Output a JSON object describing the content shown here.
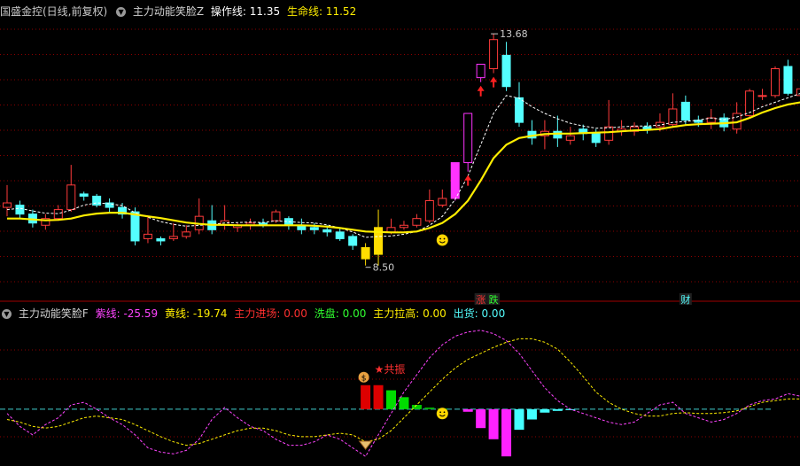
{
  "main_header": {
    "title": "国盛金控(日线,前复权)",
    "indicator": "主力动能笑脸Z",
    "op_label": "操作线:",
    "op_value": "11.35",
    "life_label": "生命线:",
    "life_value": "11.52"
  },
  "ind_header": {
    "name": "主力动能笑脸F",
    "purple_label": "紫线:",
    "purple_value": "-25.59",
    "yellow_label": "黄线:",
    "yellow_value": "-19.74",
    "enter_label": "主力进场:",
    "enter_value": "0.00",
    "wash_label": "洗盘:",
    "wash_value": "0.00",
    "pull_label": "主力拉高:",
    "pull_value": "0.00",
    "ship_label": "出货:",
    "ship_value": "0.00"
  },
  "colors": {
    "up": "#ff3b3b",
    "down": "#54ffff",
    "limit": "#ff33ff",
    "life": "#ffee00",
    "op": "#ffffff",
    "purple": "#ff44ff",
    "grid": "#8b0000",
    "zero": "#40d0d0"
  },
  "chart_data": [
    {
      "type": "candlestick",
      "ylim": [
        7.9,
        14.0
      ],
      "high_annotation": "13.68",
      "low_annotation": "8.50",
      "badges": [
        {
          "index": 37,
          "text": "涨",
          "color": "#ff3030"
        },
        {
          "index": 38,
          "text": "跌",
          "color": "#30ff30"
        },
        {
          "index": 53,
          "text": "财",
          "color": "#54ffff"
        }
      ],
      "candles": [
        [
          9.8,
          9.9,
          9.6,
          10.3
        ],
        [
          9.85,
          9.65,
          9.55,
          9.95
        ],
        [
          9.65,
          9.45,
          9.35,
          9.75
        ],
        [
          9.4,
          9.55,
          9.3,
          9.65
        ],
        [
          9.55,
          9.75,
          9.5,
          9.85
        ],
        [
          9.75,
          10.3,
          9.7,
          10.75
        ],
        [
          10.1,
          10.05,
          9.95,
          10.15
        ],
        [
          10.05,
          9.85,
          9.8,
          10.1
        ],
        [
          9.9,
          9.8,
          9.7,
          10.0
        ],
        [
          9.8,
          9.65,
          9.55,
          9.9
        ],
        [
          9.7,
          9.05,
          8.95,
          9.8
        ],
        [
          9.1,
          9.2,
          9.0,
          9.6
        ],
        [
          9.1,
          9.05,
          8.95,
          9.15
        ],
        [
          9.1,
          9.15,
          9.05,
          9.45
        ],
        [
          9.15,
          9.25,
          9.1,
          9.4
        ],
        [
          9.3,
          9.6,
          9.2,
          10.0
        ],
        [
          9.5,
          9.3,
          9.2,
          9.85
        ],
        [
          9.4,
          9.5,
          9.3,
          9.85
        ],
        [
          9.35,
          9.4,
          9.25,
          9.45
        ],
        [
          9.4,
          9.45,
          9.3,
          9.55
        ],
        [
          9.45,
          9.4,
          9.35,
          9.55
        ],
        [
          9.5,
          9.7,
          9.45,
          9.75
        ],
        [
          9.55,
          9.4,
          9.3,
          9.6
        ],
        [
          9.4,
          9.3,
          9.2,
          9.55
        ],
        [
          9.35,
          9.3,
          9.2,
          9.45
        ],
        [
          9.3,
          9.25,
          9.15,
          9.4
        ],
        [
          9.25,
          9.1,
          9.05,
          9.35
        ],
        [
          9.15,
          8.95,
          8.85,
          9.2
        ],
        [
          8.9,
          8.65,
          8.5,
          9.0
        ],
        [
          8.75,
          9.35,
          8.5,
          9.75
        ],
        [
          9.25,
          9.35,
          9.2,
          9.55
        ],
        [
          9.35,
          9.4,
          9.3,
          9.5
        ],
        [
          9.4,
          9.55,
          9.35,
          9.65
        ],
        [
          9.5,
          9.95,
          9.45,
          10.2
        ],
        [
          9.85,
          10.0,
          9.8,
          10.2
        ],
        [
          10.0,
          10.8,
          9.95,
          10.8
        ],
        [
          10.8,
          11.9,
          10.6,
          11.9
        ],
        [
          12.7,
          13.0,
          12.6,
          13.0
        ],
        [
          12.9,
          13.55,
          12.8,
          13.68
        ],
        [
          13.2,
          12.5,
          12.4,
          13.5
        ],
        [
          12.25,
          11.7,
          11.6,
          12.6
        ],
        [
          11.5,
          11.35,
          11.2,
          11.75
        ],
        [
          11.4,
          11.5,
          11.1,
          11.75
        ],
        [
          11.5,
          11.35,
          11.15,
          11.85
        ],
        [
          11.3,
          11.4,
          11.2,
          11.6
        ],
        [
          11.55,
          11.45,
          11.3,
          11.65
        ],
        [
          11.45,
          11.25,
          11.15,
          11.55
        ],
        [
          11.3,
          11.6,
          11.2,
          12.2
        ],
        [
          11.5,
          11.55,
          11.4,
          11.75
        ],
        [
          11.5,
          11.6,
          11.4,
          11.7
        ],
        [
          11.6,
          11.55,
          11.45,
          11.7
        ],
        [
          11.6,
          11.7,
          11.5,
          11.9
        ],
        [
          11.65,
          12.0,
          11.6,
          12.35
        ],
        [
          12.15,
          11.75,
          11.65,
          12.3
        ],
        [
          11.75,
          11.7,
          11.6,
          11.85
        ],
        [
          11.7,
          11.8,
          11.55,
          12.0
        ],
        [
          11.8,
          11.6,
          11.5,
          11.9
        ],
        [
          11.55,
          11.9,
          11.45,
          12.15
        ],
        [
          11.85,
          12.4,
          11.8,
          12.45
        ],
        [
          12.3,
          12.3,
          12.2,
          12.45
        ],
        [
          12.3,
          12.9,
          12.25,
          12.95
        ],
        [
          12.95,
          12.35,
          12.3,
          13.1
        ],
        [
          12.3,
          12.45,
          12.25,
          12.55
        ]
      ],
      "op_line": [
        9.75,
        9.78,
        9.72,
        9.67,
        9.66,
        9.74,
        9.85,
        9.9,
        9.88,
        9.84,
        9.68,
        9.58,
        9.48,
        9.42,
        9.38,
        9.4,
        9.42,
        9.45,
        9.46,
        9.47,
        9.46,
        9.5,
        9.48,
        9.46,
        9.45,
        9.41,
        9.34,
        9.25,
        9.13,
        9.15,
        9.16,
        9.2,
        9.26,
        9.4,
        9.6,
        9.98,
        10.5,
        11.2,
        11.9,
        12.3,
        12.24,
        12.05,
        11.9,
        11.78,
        11.68,
        11.62,
        11.57,
        11.58,
        11.6,
        11.62,
        11.62,
        11.64,
        11.7,
        11.72,
        11.75,
        11.8,
        11.76,
        11.82,
        11.92,
        12.05,
        12.15,
        12.25,
        12.35
      ],
      "life_line": [
        9.55,
        9.55,
        9.53,
        9.51,
        9.52,
        9.55,
        9.62,
        9.66,
        9.68,
        9.68,
        9.64,
        9.6,
        9.56,
        9.51,
        9.46,
        9.43,
        9.41,
        9.41,
        9.4,
        9.4,
        9.4,
        9.4,
        9.4,
        9.4,
        9.39,
        9.37,
        9.34,
        9.3,
        9.26,
        9.25,
        9.24,
        9.24,
        9.26,
        9.34,
        9.45,
        9.65,
        9.95,
        10.4,
        10.9,
        11.2,
        11.35,
        11.4,
        11.44,
        11.45,
        11.45,
        11.46,
        11.47,
        11.48,
        11.5,
        11.52,
        11.53,
        11.55,
        11.6,
        11.64,
        11.66,
        11.67,
        11.68,
        11.7,
        11.8,
        11.92,
        12.02,
        12.1,
        12.15
      ]
    },
    {
      "type": "bar+line",
      "ylim": [
        -60,
        100
      ],
      "bars": [
        0,
        0,
        0,
        0,
        0,
        0,
        0,
        0,
        0,
        0,
        0,
        0,
        0,
        0,
        0,
        0,
        0,
        0,
        0,
        0,
        0,
        0,
        0,
        0,
        0,
        0,
        0,
        0,
        28,
        28,
        22,
        14,
        5,
        2,
        1,
        0,
        -3,
        -22,
        -35,
        -55,
        -24,
        -12,
        -4,
        -2,
        -1,
        0,
        0,
        0,
        0,
        0,
        0,
        0,
        0,
        0,
        0,
        0,
        0,
        0,
        0,
        0,
        0,
        0,
        0
      ],
      "bar_colors": [
        "",
        "",
        "",
        "",
        "",
        "",
        "",
        "",
        "",
        "",
        "",
        "",
        "",
        "",
        "",
        "",
        "",
        "",
        "",
        "",
        "",
        "",
        "",
        "",
        "",
        "",
        "",
        "",
        "#dd0000",
        "#dd0000",
        "#00dd00",
        "#00dd00",
        "#00cc00",
        "#00aa00",
        "#00aa00",
        "",
        "#ff22ff",
        "#ff22ff",
        "#ff22ff",
        "#ff22ff",
        "#44ffff",
        "#44ffff",
        "#44ffff",
        "#44ffff",
        "#44ffff",
        "",
        "",
        "",
        "",
        "",
        "",
        "",
        "",
        "",
        "",
        "",
        "",
        "",
        "",
        "",
        "",
        "",
        ""
      ],
      "purple": [
        -5,
        -20,
        -30,
        -18,
        -10,
        5,
        8,
        0,
        -10,
        -18,
        -30,
        -45,
        -50,
        -52,
        -48,
        -35,
        -12,
        2,
        -10,
        -20,
        -25,
        -35,
        -42,
        -42,
        -38,
        -30,
        -35,
        -45,
        -55,
        -30,
        -5,
        20,
        40,
        60,
        75,
        85,
        90,
        92,
        88,
        80,
        65,
        45,
        25,
        10,
        0,
        -5,
        -10,
        -15,
        -18,
        -15,
        -5,
        5,
        8,
        -5,
        -10,
        -15,
        -12,
        -5,
        5,
        10,
        12,
        18,
        15
      ],
      "yellow": [
        -12,
        -15,
        -20,
        -22,
        -20,
        -15,
        -10,
        -8,
        -10,
        -12,
        -18,
        -25,
        -32,
        -38,
        -42,
        -40,
        -35,
        -30,
        -25,
        -22,
        -22,
        -25,
        -30,
        -32,
        -32,
        -30,
        -28,
        -30,
        -38,
        -35,
        -25,
        -10,
        5,
        20,
        35,
        48,
        58,
        65,
        72,
        78,
        82,
        82,
        78,
        70,
        55,
        38,
        20,
        8,
        0,
        -5,
        -8,
        -8,
        -5,
        -4,
        -5,
        -5,
        -4,
        -2,
        3,
        8,
        10,
        12,
        12
      ],
      "annotation": "★共振"
    }
  ]
}
